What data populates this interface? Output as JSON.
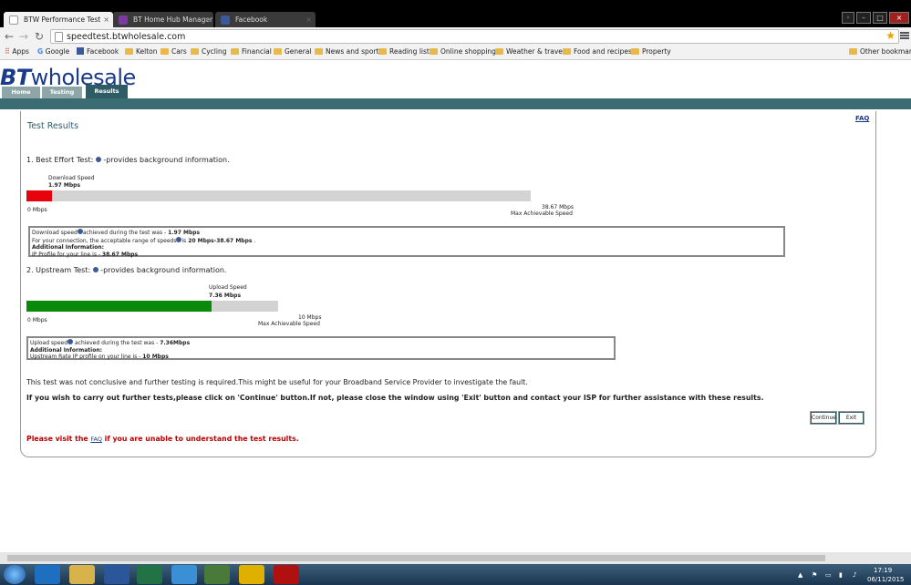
{
  "browser": {
    "tabs": [
      {
        "title": "BTW Performance Test",
        "active": true
      },
      {
        "title": "BT Home Hub Manager -",
        "active": false
      },
      {
        "title": "Facebook",
        "active": false
      }
    ],
    "url": "speedtest.btwholesale.com",
    "bookmarks": [
      "Apps",
      "Google",
      "Facebook",
      "Kelton",
      "Cars",
      "Cycling",
      "Financial",
      "General",
      "News and sport",
      "Reading list",
      "Online shopping",
      "Weather & travel",
      "Food and recipes",
      "Property"
    ],
    "other_bookmarks": "Other bookmarks"
  },
  "site": {
    "logo_bt": "BT",
    "logo_wholesale": "wholesale",
    "nav": [
      "Home",
      "Testing",
      "Results"
    ],
    "faq_link": "FAQ",
    "panel_title": "Test Results"
  },
  "download": {
    "heading": "1. Best Effort Test:",
    "heading_suffix": "-provides background information.",
    "speed_label": "Download Speed",
    "speed_value": "1.97 Mbps",
    "speed_mbps": 1.97,
    "max_mbps": 38.67,
    "min_label": "0 Mbps",
    "max_label": "38.67 Mbps",
    "max_caption": "Max Achievable Speed",
    "info_line1a": "Download speed",
    "info_line1b": "achieved during the test was - ",
    "info_line1c": "1.97 Mbps",
    "info_line2a": "For your connection, the acceptable range of speeds",
    "info_line2b": "is ",
    "info_line2c": "20 Mbps-38.67 Mbps",
    "info_line2d": " .",
    "info_line3": "Additional Information:",
    "info_line4a": "IP Profile for your line is - ",
    "info_line4b": "38.67 Mbps",
    "bar_color": "#e8000a"
  },
  "upload": {
    "heading": "2. Upstream Test:",
    "heading_suffix": "-provides background information.",
    "speed_label": "Upload Speed",
    "speed_value": "7.36 Mbps",
    "speed_mbps": 7.36,
    "max_mbps": 10,
    "min_label": "0 Mbps",
    "max_label": "10 Mbps",
    "max_caption": "Max Achievable Speed",
    "info_line1a": "Upload speed",
    "info_line1b": " achieved during the test was - ",
    "info_line1c": "7.36Mbps",
    "info_line2": "Additional Information:",
    "info_line3a": "Upstream Rate IP profile on your line is - ",
    "info_line3b": "10 Mbps",
    "bar_color": "#0a8a0a"
  },
  "messages": {
    "inconclusive": "This test was not conclusive and further testing is required.This might be useful for your Broadband Service Provider to investigate the fault.",
    "further": "If you wish to carry out further tests,please click on 'Continue' button.If not, please close the window using 'Exit' button and contact your ISP for further assistance with these results.",
    "visit_a": "Please visit the ",
    "visit_link": "FAQ",
    "visit_b": " if you are unable to understand the test results."
  },
  "buttons": {
    "continue": "Continue",
    "exit": "Exit"
  },
  "taskbar": {
    "time": "17:19",
    "date": "06/11/2015"
  },
  "colors": {
    "bt_blue": "#1a3a8a",
    "bt_teal": "#3b6b73",
    "warning_red": "#c00000"
  }
}
